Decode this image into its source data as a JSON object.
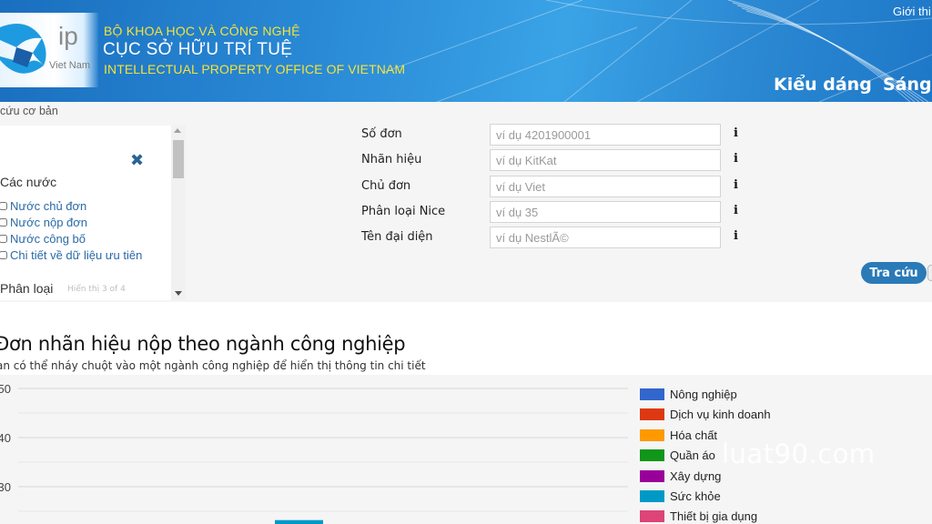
{
  "header": {
    "logo_ip": "ip",
    "logo_country": "Viet Nam",
    "org_line1": "BỘ KHOA HỌC VÀ CÔNG NGHỆ",
    "org_line2": "CỤC SỞ HỮU TRÍ TUỆ",
    "org_line3": "INTELLECTUAL PROPERTY OFFICE OF VIETNAM",
    "top_link": "Giới thi",
    "nav": [
      {
        "label": "Kiểu dáng"
      },
      {
        "label": "Sáng c"
      }
    ]
  },
  "breadcrumb": "cứu cơ bản",
  "filter_panel": {
    "close_icon": "close-x-icon",
    "section1_title": "Các nước",
    "checkboxes": [
      {
        "label": "Nước chủ đơn",
        "checked": false
      },
      {
        "label": "Nước nộp đơn",
        "checked": false
      },
      {
        "label": "Nước công bố",
        "checked": false
      },
      {
        "label": "Chi tiết về dữ liệu ưu tiên",
        "checked": false
      }
    ],
    "section2_title": "Phân loại",
    "section2_hint": "Hiển thị 3 of 4"
  },
  "search_form": {
    "fields": [
      {
        "label": "Số đơn",
        "value": "",
        "placeholder": "ví dụ 4201900001"
      },
      {
        "label": "Nhãn hiệu",
        "value": "",
        "placeholder": "ví dụ KitKat"
      },
      {
        "label": "Chủ đơn",
        "value": "",
        "placeholder": "ví dụ Viet"
      },
      {
        "label": "Phân loại Nice",
        "value": "",
        "placeholder": "ví dụ 35"
      },
      {
        "label": "Tên đại diện",
        "value": "",
        "placeholder": "ví dụ NestlÃ©"
      }
    ],
    "info_icon": "i",
    "search_button": "Tra cứu"
  },
  "chart_section": {
    "title": "Đơn nhãn hiệu nộp theo ngành công nghiệp",
    "subtitle": "ạn có thể nháy chuột vào một ngành công nghiệp để hiển thị thông tin chi tiết"
  },
  "chart_data": {
    "type": "bar",
    "title": "Đơn nhãn hiệu nộp theo ngành công nghiệp",
    "xlabel": "",
    "ylabel": "",
    "y_ticks": [
      50,
      40,
      30
    ],
    "ylim_visible": [
      23,
      51
    ],
    "grid": true,
    "legend_position": "right",
    "series": [
      {
        "name": "Nông nghiệp",
        "color": "#3366cc"
      },
      {
        "name": "Dịch vụ kinh doanh",
        "color": "#dc3912"
      },
      {
        "name": "Hóa chất",
        "color": "#ff9900"
      },
      {
        "name": "Quần áo",
        "color": "#109618"
      },
      {
        "name": "Xây dựng",
        "color": "#990099"
      },
      {
        "name": "Sức khỏe",
        "color": "#0099c6"
      },
      {
        "name": "Thiết bị gia dụng",
        "color": "#dd4477"
      }
    ],
    "visible_bars": [
      {
        "series": "Sức khỏe",
        "value_at_least": 23.2
      }
    ]
  },
  "watermark": "luat90.com"
}
